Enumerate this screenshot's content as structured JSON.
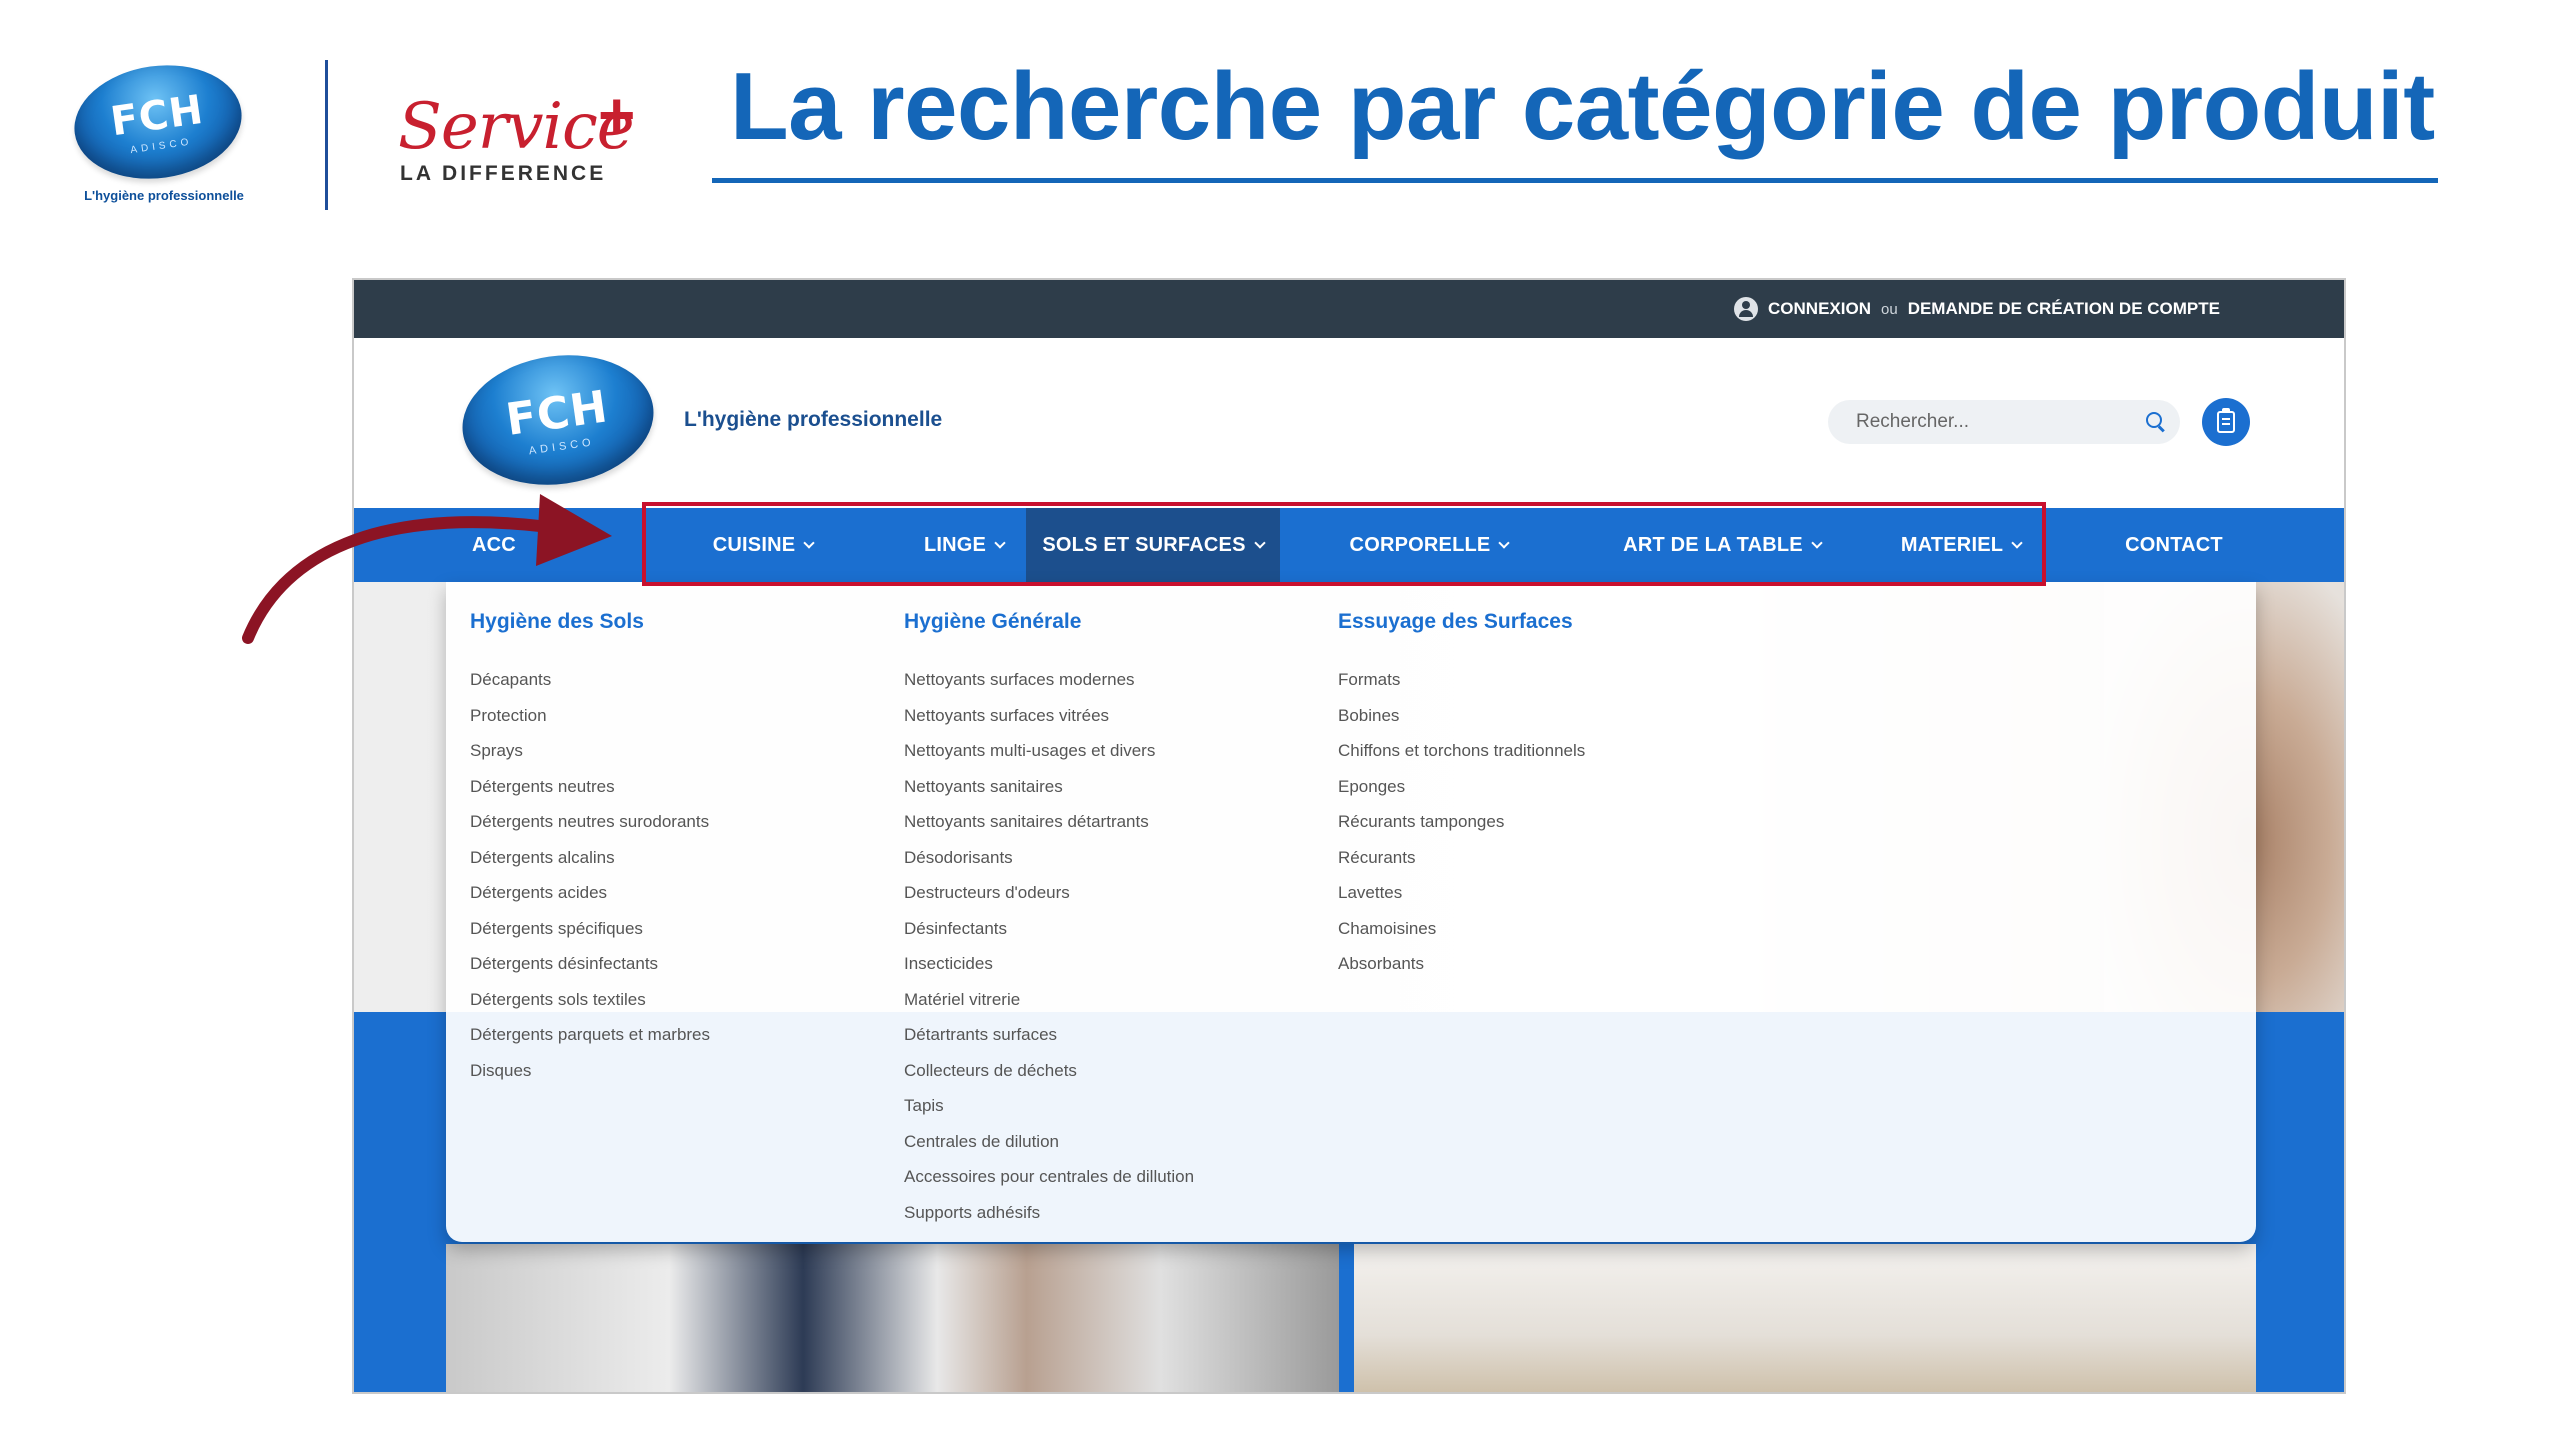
{
  "slide": {
    "title": "La recherche par catégorie de produit",
    "logo": {
      "main": "FCH",
      "sub": "ADISCO",
      "tagline": "L'hygiène professionnelle"
    },
    "service": {
      "word": "Service",
      "plus": "+",
      "subtitle": "LA DIFFERENCE"
    }
  },
  "site": {
    "topbar": {
      "login": "CONNEXION",
      "or": "ou",
      "register": "DEMANDE DE CRÉATION DE COMPTE"
    },
    "header": {
      "logo_main": "FCH",
      "logo_sub": "ADISCO",
      "tagline": "L'hygiène professionnelle",
      "search_placeholder": "Rechercher..."
    },
    "nav": {
      "items": [
        {
          "label": "ACC"
        },
        {
          "label": "CUISINE"
        },
        {
          "label": "LINGE"
        },
        {
          "label": "SOLS ET SURFACES"
        },
        {
          "label": "CORPORELLE"
        },
        {
          "label": "ART DE LA TABLE"
        },
        {
          "label": "MATERIEL"
        },
        {
          "label": "CONTACT"
        }
      ]
    },
    "menu": {
      "columns": [
        {
          "title": "Hygiène des Sols",
          "items": [
            "Décapants",
            "Protection",
            "Sprays",
            "Détergents neutres",
            "Détergents neutres surodorants",
            "Détergents alcalins",
            "Détergents acides",
            "Détergents spécifiques",
            "Détergents désinfectants",
            "Détergents sols textiles",
            "Détergents parquets et marbres",
            "Disques"
          ]
        },
        {
          "title": "Hygiène Générale",
          "items": [
            "Nettoyants surfaces modernes",
            "Nettoyants surfaces vitrées",
            "Nettoyants multi-usages et divers",
            "Nettoyants sanitaires",
            "Nettoyants sanitaires détartrants",
            "Désodorisants",
            "Destructeurs d'odeurs",
            "Désinfectants",
            "Insecticides",
            "Matériel vitrerie",
            "Détartrants surfaces",
            "Collecteurs de déchets",
            "Tapis",
            "Centrales de dilution",
            "Accessoires pour centrales de dillution",
            "Supports adhésifs"
          ]
        },
        {
          "title": "Essuyage des Surfaces",
          "items": [
            "Formats",
            "Bobines",
            "Chiffons et torchons traditionnels",
            "Eponges",
            "Récurants tamponges",
            "Récurants",
            "Lavettes",
            "Chamoisines",
            "Absorbants"
          ]
        }
      ]
    }
  },
  "colors": {
    "title_blue": "#1466b8",
    "nav_blue": "#1b6fd0",
    "nav_active": "#1c4f8d",
    "topbar": "#2e3d4a",
    "highlight_red": "#c8102e",
    "arrow": "#8c1424",
    "service_red": "#c8202f"
  }
}
